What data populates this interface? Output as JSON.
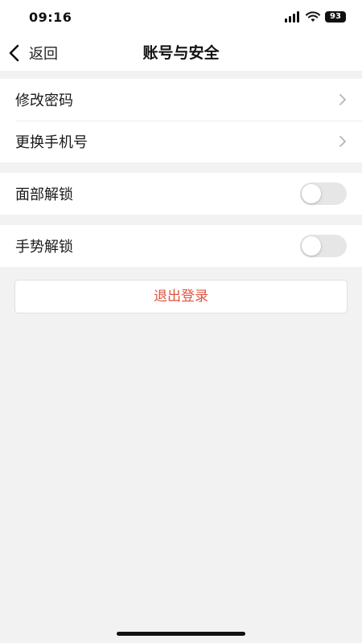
{
  "status_bar": {
    "time": "09:16",
    "battery": "93"
  },
  "nav": {
    "back_label": "返回",
    "title": "账号与安全"
  },
  "groups": [
    {
      "items": [
        {
          "label": "修改密码",
          "type": "link"
        },
        {
          "label": "更换手机号",
          "type": "link"
        }
      ]
    },
    {
      "items": [
        {
          "label": "面部解锁",
          "type": "toggle",
          "enabled": false
        }
      ]
    },
    {
      "items": [
        {
          "label": "手势解锁",
          "type": "toggle",
          "enabled": false
        }
      ]
    }
  ],
  "logout_label": "退出登录",
  "colors": {
    "background": "#f2f2f2",
    "accent_red": "#e0533f",
    "toggle_off": "#e6e6e6"
  },
  "icons": {
    "back": "chevron-left-icon",
    "row_link": "chevron-right-icon"
  }
}
